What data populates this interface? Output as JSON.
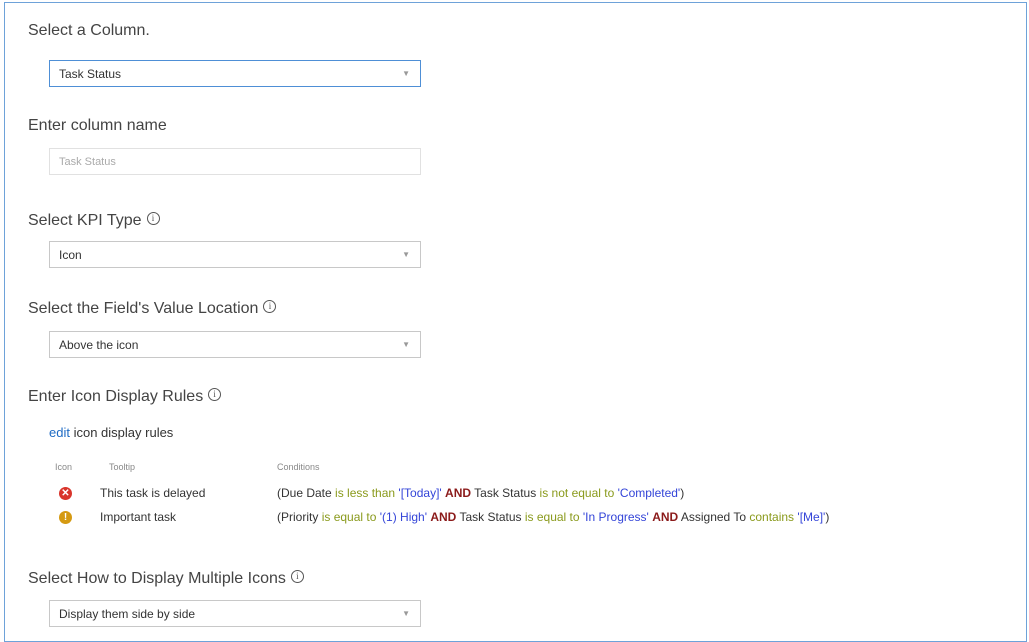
{
  "column_select": {
    "label": "Select a Column.",
    "value": "Task Status"
  },
  "column_name": {
    "label": "Enter column name",
    "placeholder": "Task Status"
  },
  "kpi_type": {
    "label": "Select KPI Type",
    "value": "Icon"
  },
  "value_location": {
    "label": "Select the Field's Value Location",
    "value": "Above the icon"
  },
  "icon_rules": {
    "label": "Enter Icon Display Rules",
    "edit_link": "edit",
    "edit_text": "icon display rules",
    "headers": {
      "icon": "Icon",
      "tooltip": "Tooltip",
      "conditions": "Conditions"
    },
    "rules": [
      {
        "icon": "error-circle-icon",
        "icon_color": "#d9342b",
        "icon_glyph": "✕",
        "tooltip": "This task is delayed",
        "c1": "(Due Date",
        "c2": "is less than",
        "c3": "'[Today]'",
        "c4": "AND",
        "c5": "Task Status",
        "c6": "is not equal to",
        "c7": "'Completed'",
        "c8": ")"
      },
      {
        "icon": "warning-circle-icon",
        "icon_color": "#d59a12",
        "icon_glyph": "!",
        "tooltip": "Important task",
        "c1": "(Priority",
        "c2": "is equal to",
        "c3": "'(1) High'",
        "c4": "AND",
        "c5": "Task Status",
        "c6": "is equal to",
        "c7": "'In Progress'",
        "c8": "AND",
        "c9": "Assigned To",
        "c10": "contains",
        "c11": "'[Me]'",
        "c12": ")"
      }
    ]
  },
  "multiple_icons": {
    "label": "Select How to Display Multiple Icons",
    "value": "Display them side by side"
  },
  "colors": {
    "frame_border": "#6ea2d9",
    "link": "#1e6bc4",
    "operator": "#8a9a1c",
    "value": "#3344d8",
    "and": "#8b1a1a"
  }
}
